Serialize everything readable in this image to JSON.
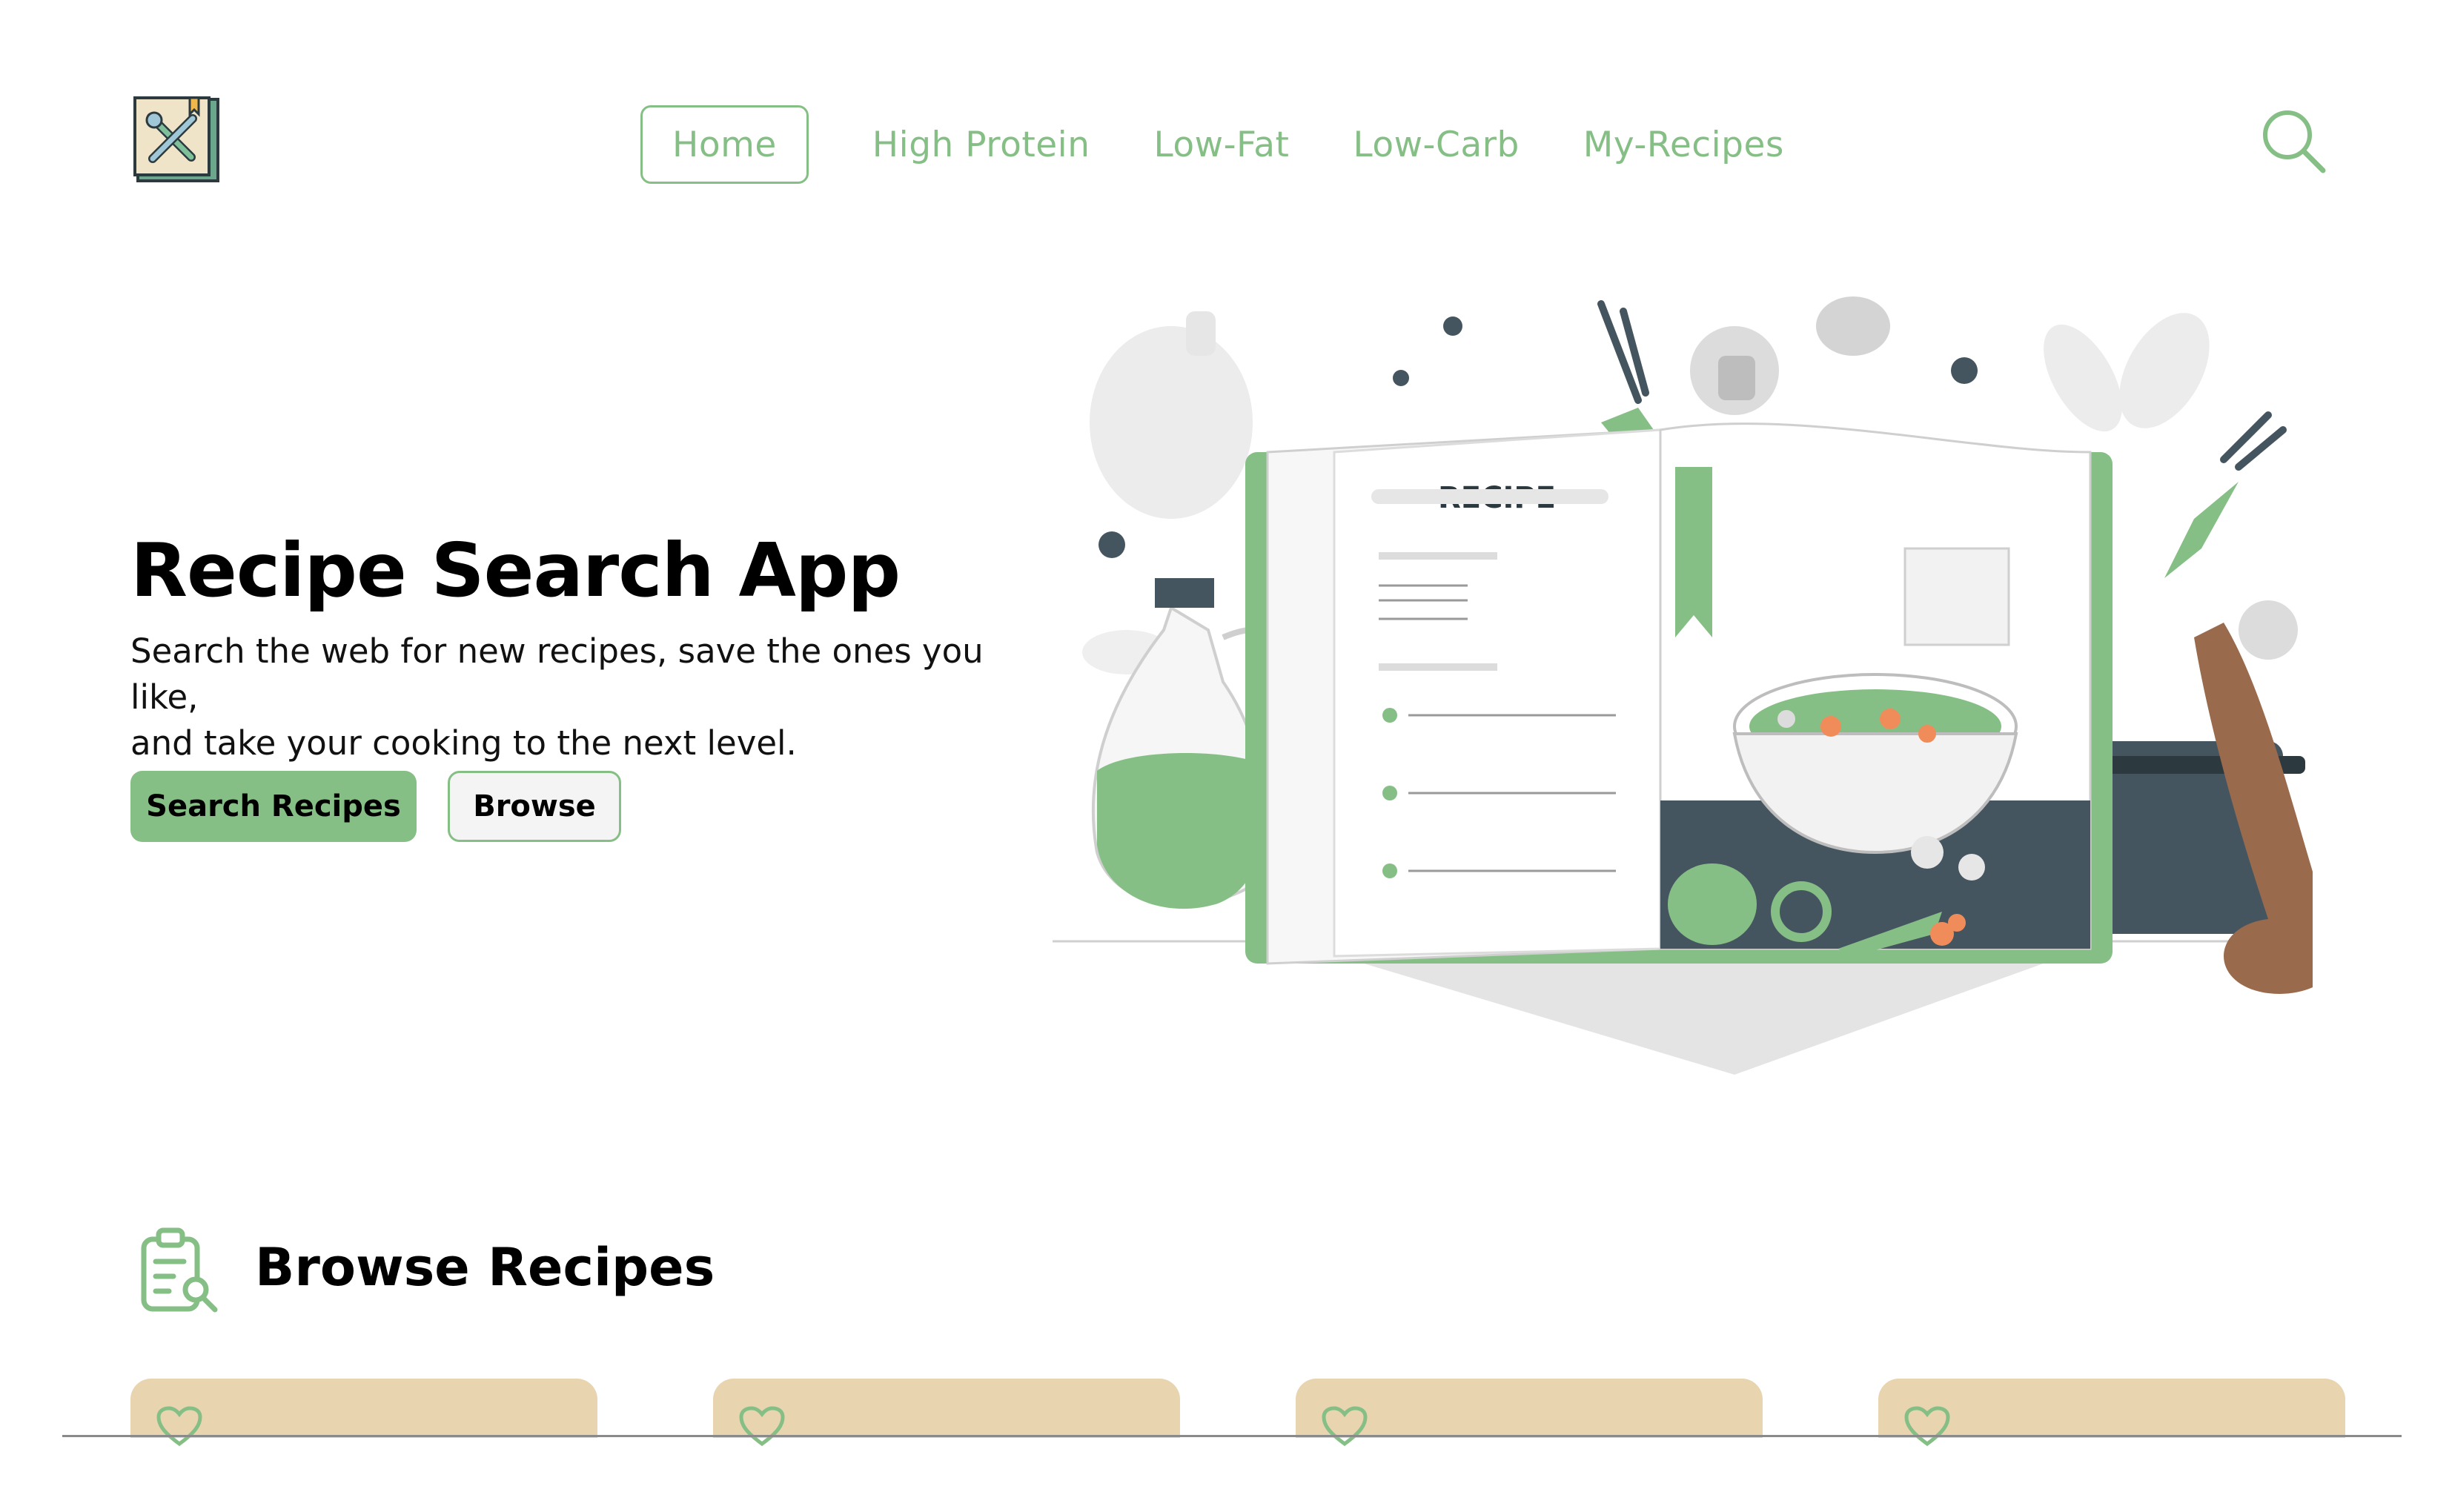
{
  "header": {
    "logo_icon": "cookbook-logo-icon",
    "nav": [
      {
        "label": "Home",
        "active": true
      },
      {
        "label": "High Protein",
        "active": false
      },
      {
        "label": "Low-Fat",
        "active": false
      },
      {
        "label": "Low-Carb",
        "active": false
      },
      {
        "label": "My-Recipes",
        "active": false
      }
    ],
    "search_icon": "search-icon"
  },
  "hero": {
    "title": "Recipe Search App",
    "subtitle_line1": "Search the web for new recipes, save the ones you like,",
    "subtitle_line2": "and take your cooking to the next level.",
    "primary_button": "Search Recipes",
    "secondary_button": "Browse",
    "illustration_text": "RECIPE"
  },
  "browse": {
    "title": "Browse Recipes",
    "icon": "clipboard-search-icon",
    "cards": [
      {
        "favorite_icon": "heart-icon"
      },
      {
        "favorite_icon": "heart-icon"
      },
      {
        "favorite_icon": "heart-icon"
      },
      {
        "favorite_icon": "heart-icon"
      }
    ]
  },
  "colors": {
    "accent": "#86bf86",
    "card": "#e8d4ae",
    "dark": "#455560",
    "background": "#ffffff"
  }
}
